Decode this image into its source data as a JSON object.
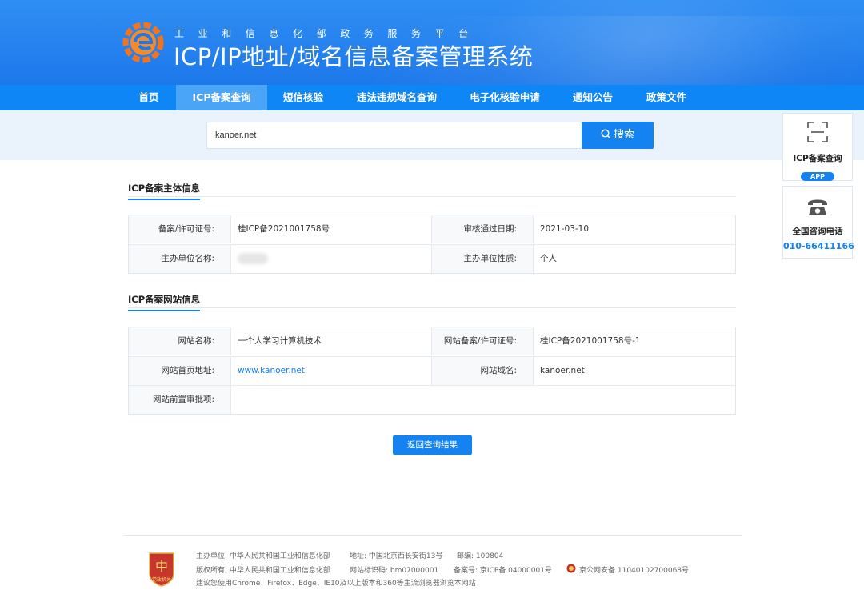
{
  "header": {
    "subtitle": "工业和信息化部政务服务平台",
    "title": "ICP/IP地址/域名信息备案管理系统"
  },
  "nav": {
    "items": [
      "首页",
      "ICP备案查询",
      "短信核验",
      "违法违规域名查询",
      "电子化核验申请",
      "通知公告",
      "政策文件"
    ],
    "active": "ICP备案查询"
  },
  "search": {
    "value": "kanoer.net",
    "button_label": "搜索"
  },
  "widgets": {
    "app_label": "ICP备案查询",
    "app_badge": "APP",
    "phone_label": "全国咨询电话",
    "phone_number": "010-66411166"
  },
  "subject_section": {
    "title": "ICP备案主体信息",
    "rows": [
      {
        "label1": "备案/许可证号:",
        "value1": "桂ICP备2021001758号",
        "label2": "审核通过日期:",
        "value2": "2021-03-10"
      },
      {
        "label1": "主办单位名称:",
        "value1": "",
        "label2": "主办单位性质:",
        "value2": "个人"
      }
    ]
  },
  "website_section": {
    "title": "ICP备案网站信息",
    "rows": [
      {
        "label1": "网站名称:",
        "value1": "一个人学习计算机技术",
        "label2": "网站备案/许可证号:",
        "value2": "桂ICP备2021001758号-1"
      },
      {
        "label1": "网站首页地址:",
        "value1": "www.kanoer.net",
        "label2": "网站域名:",
        "value2": "kanoer.net"
      },
      {
        "label1": "网站前置审批项:",
        "value1": ""
      }
    ]
  },
  "back_button": "返回查询结果",
  "footer": {
    "line1": [
      "主办单位: 中华人民共和国工业和信息化部",
      "地址: 中国北京西长安街13号",
      "邮编: 100804"
    ],
    "line2": [
      "版权所有: 中华人民共和国工业和信息化部",
      "网站标识码: bm07000001",
      "备案号: 京ICP备 04000001号",
      "京公网安备 11040102700068号"
    ],
    "line3": "建议您使用Chrome、Firefox、Edge、IE10及以上版本和360等主流浏览器浏览本网站",
    "logo_text": "党政机关"
  },
  "colors": {
    "primary": "#1482f0",
    "nav_bg": "#0f86f5",
    "header_bg": "#2f8ef3",
    "search_band_bg": "#eaf3fc"
  }
}
